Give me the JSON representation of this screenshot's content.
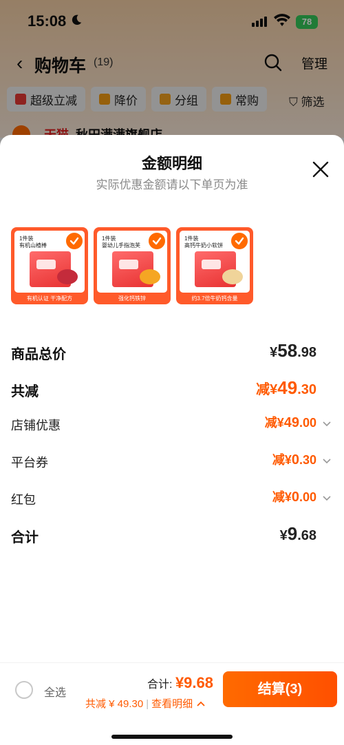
{
  "status": {
    "time": "15:08",
    "battery": "78"
  },
  "nav": {
    "back": "‹",
    "title": "购物车",
    "count": "(19)",
    "manage": "管理"
  },
  "chips": [
    {
      "label": "超级立减",
      "color": "#e53935"
    },
    {
      "label": "降价",
      "color": "#f39c12"
    },
    {
      "label": "分组",
      "color": "#f0a020"
    },
    {
      "label": "常购",
      "color": "#f39c12"
    }
  ],
  "filter": "筛选",
  "store": {
    "tag": "天猫",
    "name": "秋田满满旗舰店"
  },
  "sheet": {
    "title": "金额明细",
    "subtitle": "实际优惠金额请以下单页为准",
    "products": [
      {
        "qty": "1件装",
        "name": "有机山楂棒",
        "tag": "有机认证 干净配方",
        "snack_color": "#c42b3b"
      },
      {
        "qty": "1件装",
        "name": "婴幼儿手指泡芙",
        "tag": "强化钙铁锌",
        "snack_color": "#f5a623"
      },
      {
        "qty": "1件装",
        "name": "高钙牛奶小软饼",
        "tag": "约3.7倍牛奶钙含量",
        "snack_color": "#f0d49a"
      }
    ],
    "rows": [
      {
        "label": "商品总价",
        "prefix": "¥",
        "int": "58",
        "dec": ".98",
        "style": "bold"
      },
      {
        "label": "共减",
        "prefix": "减¥",
        "int": "49",
        "dec": ".30",
        "style": "bold-orange"
      },
      {
        "label": "店铺优惠",
        "prefix": "减¥",
        "int": "49",
        "dec": ".00",
        "style": "orange-chev"
      },
      {
        "label": "平台券",
        "prefix": "减¥",
        "int": "0",
        "dec": ".30",
        "style": "orange-chev"
      },
      {
        "label": "红包",
        "prefix": "减¥",
        "int": "0",
        "dec": ".00",
        "style": "orange-chev"
      },
      {
        "label": "合计",
        "prefix": "¥",
        "int": "9",
        "dec": ".68",
        "style": "bold"
      }
    ]
  },
  "bottom": {
    "select_all": "全选",
    "total_label": "合计: ",
    "total_value": "¥9.68",
    "reduce_text": "共减 ¥ 49.30",
    "separator": "|",
    "view_detail": "查看明细",
    "checkout": "结算(3)"
  },
  "colors": {
    "accent": "#ff5a00",
    "checkout": "#ff6a00"
  }
}
